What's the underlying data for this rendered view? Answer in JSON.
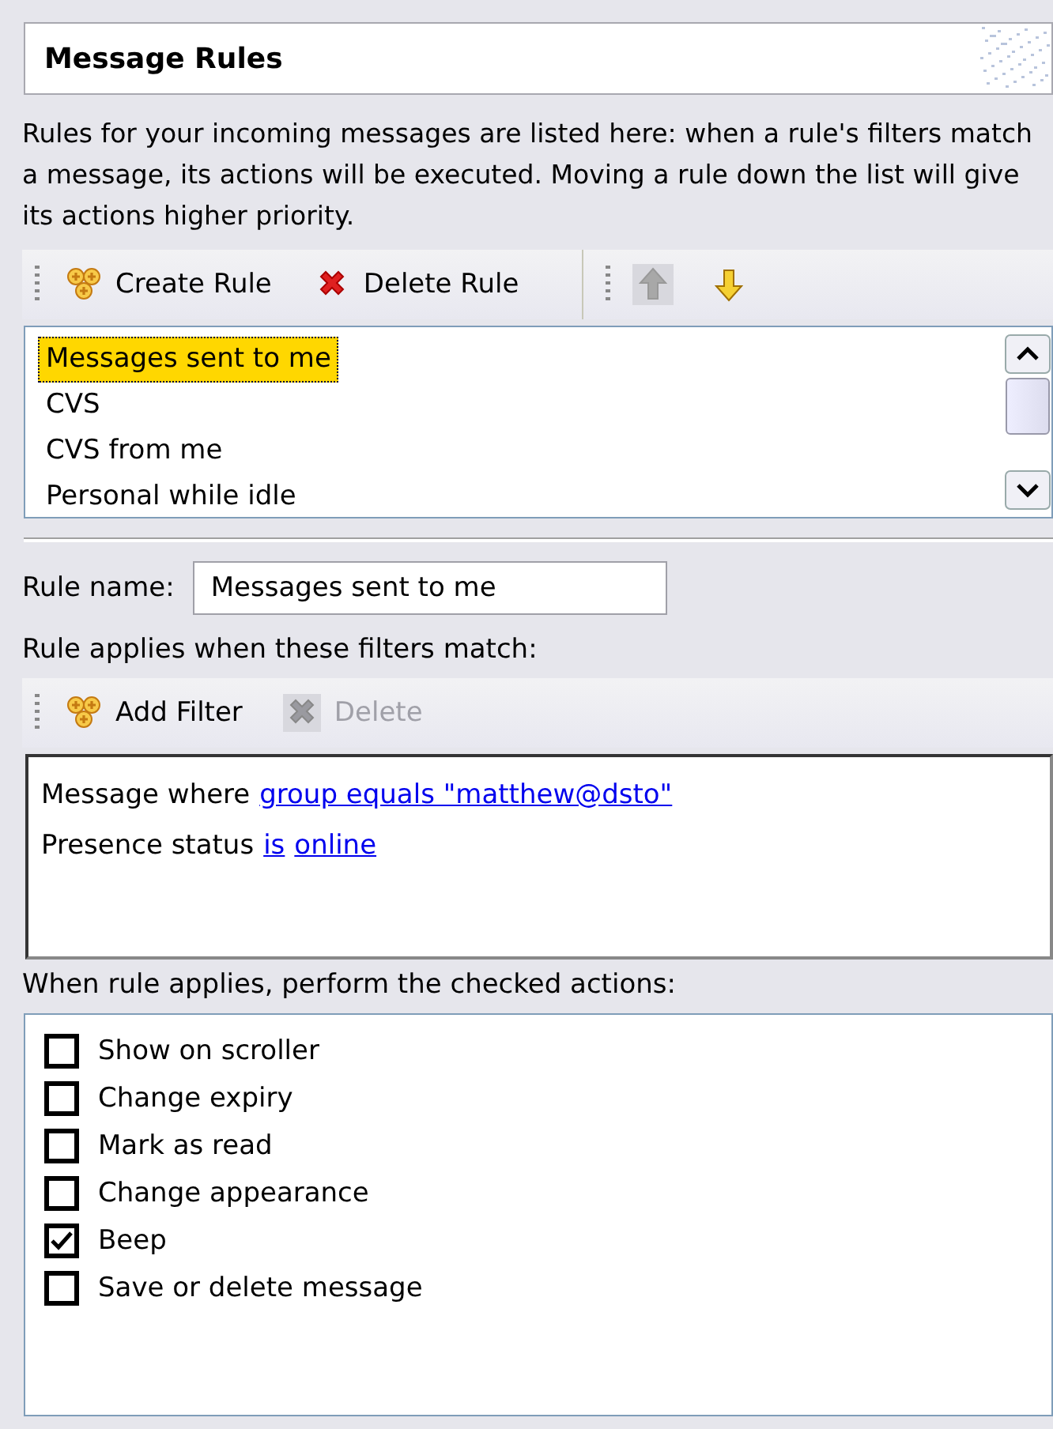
{
  "header": {
    "title": "Message Rules"
  },
  "description": "Rules for your incoming messages are listed here: when a rule's filters match a message, its actions will be executed. Moving a rule down the list will give its actions higher priority.",
  "rule_toolbar": [
    {
      "kind": "add",
      "label": "Create Rule",
      "disabled": false
    },
    {
      "kind": "delete",
      "label": "Delete Rule",
      "disabled": false
    },
    {
      "kind": "separator"
    },
    {
      "kind": "up",
      "disabled": true
    },
    {
      "kind": "down",
      "disabled": false
    }
  ],
  "rules": [
    {
      "label": "Messages sent to me",
      "selected": true
    },
    {
      "label": "CVS",
      "selected": false
    },
    {
      "label": "CVS from me",
      "selected": false
    },
    {
      "label": "Personal while idle",
      "selected": false
    }
  ],
  "rule_name": {
    "label": "Rule name:",
    "value": "Messages sent to me"
  },
  "filters_label": "Rule applies when these filters match:",
  "filter_toolbar": [
    {
      "kind": "add",
      "label": "Add Filter",
      "disabled": false
    },
    {
      "kind": "delete",
      "label": "Delete",
      "disabled": true
    }
  ],
  "filters": [
    {
      "text": "Message where",
      "links": [
        "group equals \"matthew@dsto\""
      ]
    },
    {
      "text": "Presence status",
      "links": [
        "is",
        "online"
      ]
    }
  ],
  "actions_label": "When rule applies, perform the checked actions:",
  "actions": [
    {
      "label": "Show on scroller",
      "checked": false
    },
    {
      "label": "Change expiry",
      "checked": false
    },
    {
      "label": "Mark as read",
      "checked": false
    },
    {
      "label": "Change appearance",
      "checked": false
    },
    {
      "label": "Beep",
      "checked": true
    },
    {
      "label": "Save or delete message",
      "checked": false
    }
  ]
}
